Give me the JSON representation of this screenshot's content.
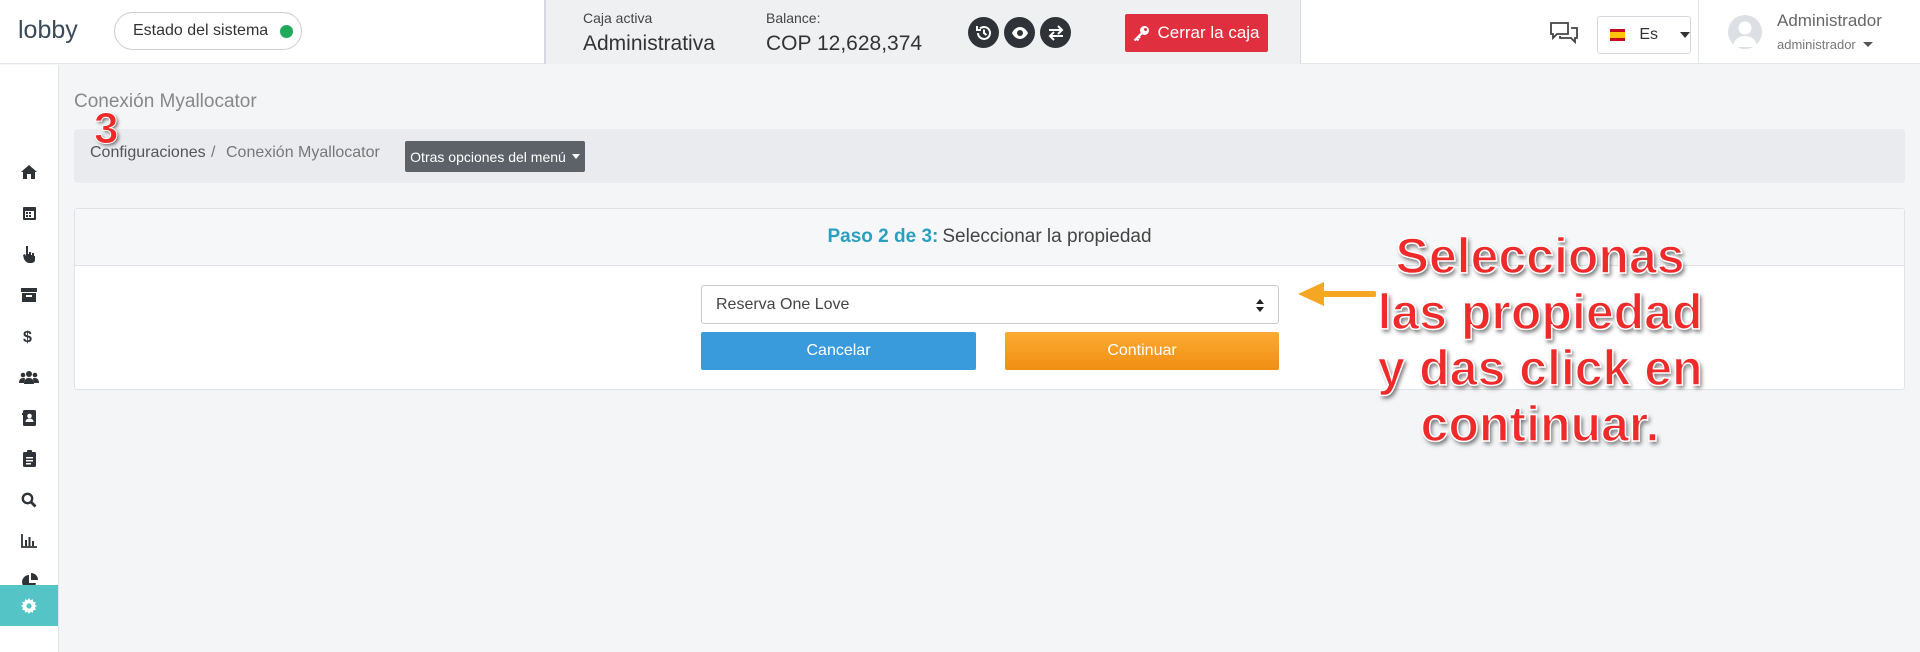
{
  "header": {
    "logo_text": "lobby",
    "system_status_label": "Estado del sistema",
    "status_color": "#1faa5b",
    "cash": {
      "active_label": "Caja activa",
      "active_value": "Administrativa",
      "balance_label": "Balance:",
      "balance_value": "COP 12,628,374",
      "close_button_label": "Cerrar la caja",
      "icons": [
        "history-icon",
        "eye-icon",
        "transfer-icon",
        "key-icon"
      ]
    },
    "language": {
      "selected": "Es"
    },
    "user": {
      "name": "Administrador",
      "role": "administrador"
    }
  },
  "sidebar": {
    "items": [
      {
        "icon": "home-icon"
      },
      {
        "icon": "calendar-icon"
      },
      {
        "icon": "pointer-hand-icon"
      },
      {
        "icon": "archive-icon"
      },
      {
        "icon": "dollar-icon"
      },
      {
        "icon": "users-icon"
      },
      {
        "icon": "contact-book-icon"
      },
      {
        "icon": "clipboard-icon"
      },
      {
        "icon": "search-icon"
      },
      {
        "icon": "bar-chart-icon"
      },
      {
        "icon": "pie-chart-icon"
      },
      {
        "icon": "gear-icon",
        "active": true
      }
    ],
    "active_color": "#54c4c6"
  },
  "page": {
    "title": "Conexión Myallocator",
    "breadcrumb": [
      "Configuraciones",
      "Conexión Myallocator"
    ],
    "breadcrumb_separator": "/",
    "menu_button_label": "Otras opciones del menú"
  },
  "wizard": {
    "step_label": "Paso 2 de 3:",
    "step_text": "Seleccionar la propiedad",
    "property_select": {
      "selected": "Reserva One Love"
    },
    "cancel_label": "Cancelar",
    "continue_label": "Continuar"
  },
  "annotations": {
    "number": "3",
    "callout_lines": [
      "Seleccionas",
      "las propiedad",
      "y das click en",
      "continuar."
    ],
    "arrow_color": "#f5a623"
  }
}
